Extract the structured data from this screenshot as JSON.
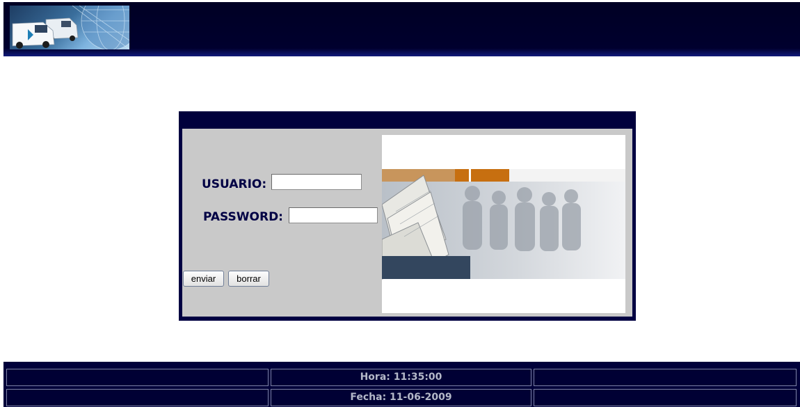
{
  "colors": {
    "header_bg": "#00002e",
    "box_frame": "#000042",
    "panel_gray": "#c9c9c9",
    "label_navy": "#000044",
    "footer_text": "#b4b8c8",
    "accent_orange": "#c76f10",
    "accent_slate": "#33465e"
  },
  "header": {
    "logo_icon": "delivery-vans-globe-logo"
  },
  "login": {
    "username_label": "USUARIO:",
    "username_value": "",
    "password_label": "PASSWORD:",
    "password_value": "",
    "send_label": "enviar",
    "clear_label": "borrar",
    "image_icon": "business-team-documents-photo"
  },
  "footer": {
    "rows": [
      {
        "left": "",
        "center": "Hora: 11:35:00",
        "right": ""
      },
      {
        "left": "",
        "center": "Fecha: 11-06-2009",
        "right": ""
      }
    ]
  }
}
